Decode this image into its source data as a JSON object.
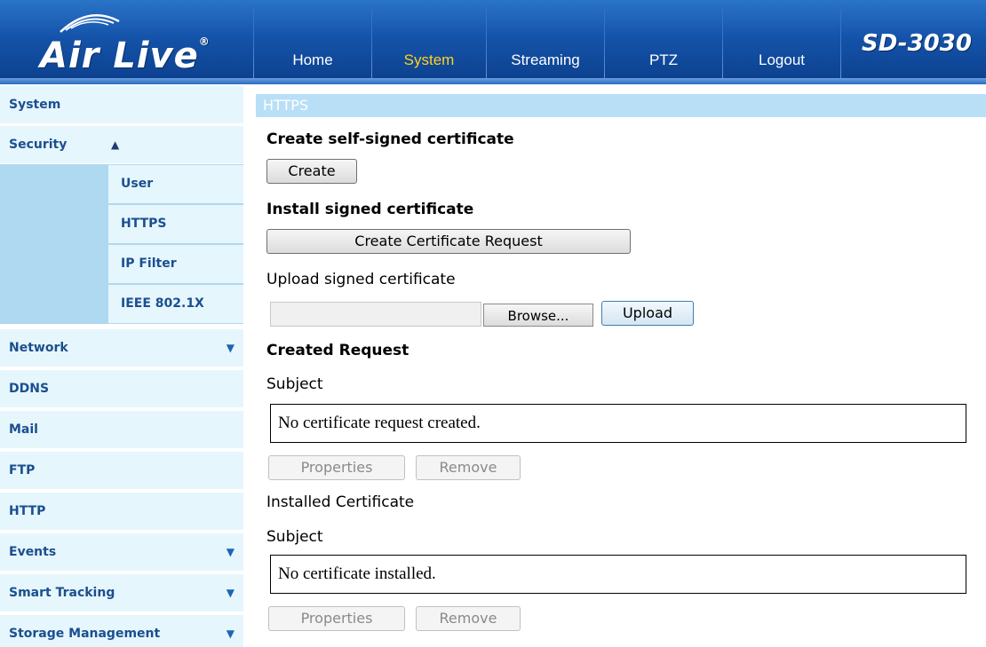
{
  "header": {
    "logo_text": "Air Live",
    "logo_reg": "®",
    "model": "SD-3030",
    "tabs": [
      {
        "label": "Home",
        "active": false
      },
      {
        "label": "System",
        "active": true
      },
      {
        "label": "Streaming",
        "active": false
      },
      {
        "label": "PTZ",
        "active": false
      },
      {
        "label": "Logout",
        "active": false
      }
    ]
  },
  "sidebar": {
    "items": [
      {
        "label": "System"
      },
      {
        "label": "Security",
        "arrow": "▲"
      },
      {
        "label": "Network",
        "arrow": "▼"
      },
      {
        "label": "DDNS"
      },
      {
        "label": "Mail"
      },
      {
        "label": "FTP"
      },
      {
        "label": "HTTP"
      },
      {
        "label": "Events",
        "arrow": "▼"
      },
      {
        "label": "Smart Tracking",
        "arrow": "▼"
      },
      {
        "label": "Storage Management",
        "arrow": "▼"
      }
    ],
    "security_sub": [
      {
        "label": "User"
      },
      {
        "label": "HTTPS"
      },
      {
        "label": "IP Filter"
      },
      {
        "label": "IEEE 802.1X"
      }
    ]
  },
  "main": {
    "section_title": "HTTPS",
    "self_signed_heading": "Create self-signed certificate",
    "create_button": "Create",
    "install_heading": "Install signed certificate",
    "create_request_button": "Create Certificate Request",
    "upload_label": "Upload signed certificate",
    "file_value": "",
    "browse_button": "Browse...",
    "upload_button": "Upload",
    "created_request_heading": "Created Request",
    "subject_label_1": "Subject",
    "request_subject": "No certificate request created.",
    "properties_button": "Properties",
    "remove_button": "Remove",
    "installed_heading": "Installed Certificate",
    "subject_label_2": "Subject",
    "installed_subject": "No certificate installed."
  },
  "colors": {
    "header_blue": "#1453a9",
    "active_tab": "#ffd21e",
    "sidebar_bg": "#e6f6fd",
    "sidebar_sub_bg": "#aed9f1",
    "sidebar_text": "#1b4f8f",
    "section_bar": "#b8dff6"
  }
}
